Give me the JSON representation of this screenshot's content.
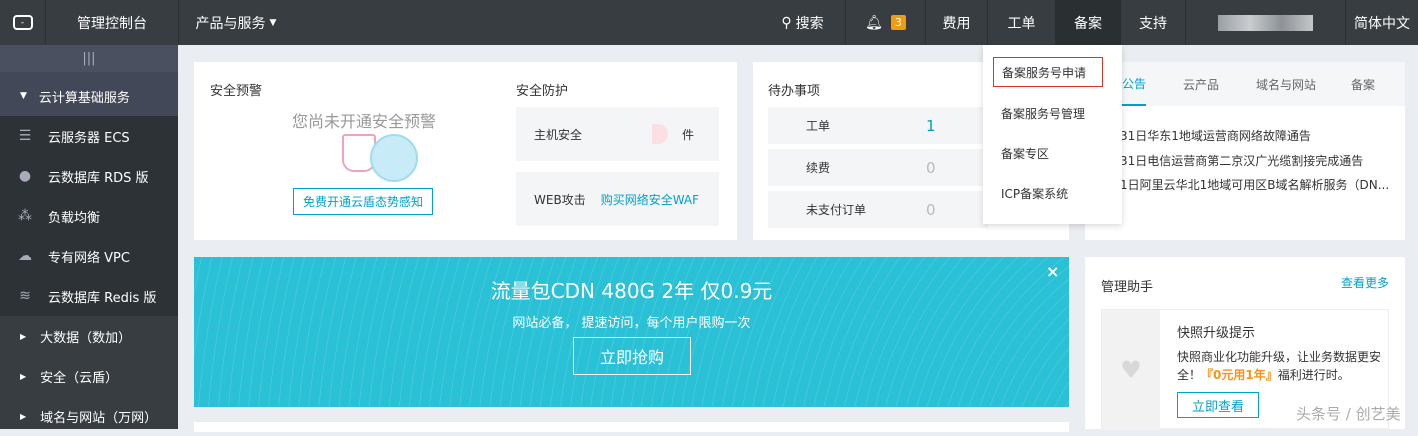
{
  "topbar": {
    "console": "管理控制台",
    "products": "产品与服务",
    "search": "搜索",
    "bell_count": "3",
    "fees": "费用",
    "tickets": "工单",
    "beian": "备案",
    "support": "支持",
    "language": "简体中文"
  },
  "sidebar": {
    "section": "云计算基础服务",
    "items": [
      {
        "label": "云服务器 ECS",
        "icon": "server-icon"
      },
      {
        "label": "云数据库 RDS 版",
        "icon": "database-icon"
      },
      {
        "label": "负载均衡",
        "icon": "load-balance-icon"
      },
      {
        "label": "专有网络 VPC",
        "icon": "cloud-icon"
      },
      {
        "label": "云数据库 Redis 版",
        "icon": "redis-icon"
      }
    ],
    "groups": [
      "大数据（数加）",
      "安全（云盾）",
      "域名与网站（万网）"
    ]
  },
  "security_alert": {
    "title": "安全预警",
    "empty_text": "您尚未开通安全预警",
    "button": "免费开通云盾态势感知"
  },
  "security_protect": {
    "title": "安全防护",
    "host_label": "主机安全",
    "host_unit": "件",
    "web_label": "WEB攻击",
    "web_link": "购买网络安全WAF"
  },
  "todo": {
    "title": "待办事项",
    "items": [
      {
        "label": "工单",
        "value": "1"
      },
      {
        "label": "续费",
        "value": "0"
      },
      {
        "label": "未支付订单",
        "value": "0"
      }
    ]
  },
  "dropdown": {
    "items": [
      "备案服务号申请",
      "备案服务号管理",
      "备案专区",
      "ICP备案系统"
    ]
  },
  "notices": {
    "tabs": [
      "公告",
      "云产品",
      "域名与网站",
      "备案"
    ],
    "items": [
      "31日华东1地域运营商网络故障通告",
      "31日电信运营商第二京汉广光缆割接完成通告",
      "1日阿里云华北1地域可用区B域名解析服务（DN..."
    ]
  },
  "banner": {
    "title": "流量包CDN 480G 2年 仅0.9元",
    "subtitle": "网站必备， 提速访问，每个用户限购一次",
    "button": "立即抢购",
    "close": "×"
  },
  "helper": {
    "title": "管理助手",
    "more": "查看更多",
    "card_title": "快照升级提示",
    "card_text": "快照商业化功能升级，让业务数据更安全！",
    "highlight": "『0元用1年』",
    "card_text2": "福利进行时。",
    "button": "立即查看"
  },
  "watermark": "头条号 / 创艺美",
  "colors": {
    "accent": "#00a2ca",
    "topbar": "#373d41",
    "banner": "#2ac0d6",
    "badge": "#f19b0f"
  }
}
